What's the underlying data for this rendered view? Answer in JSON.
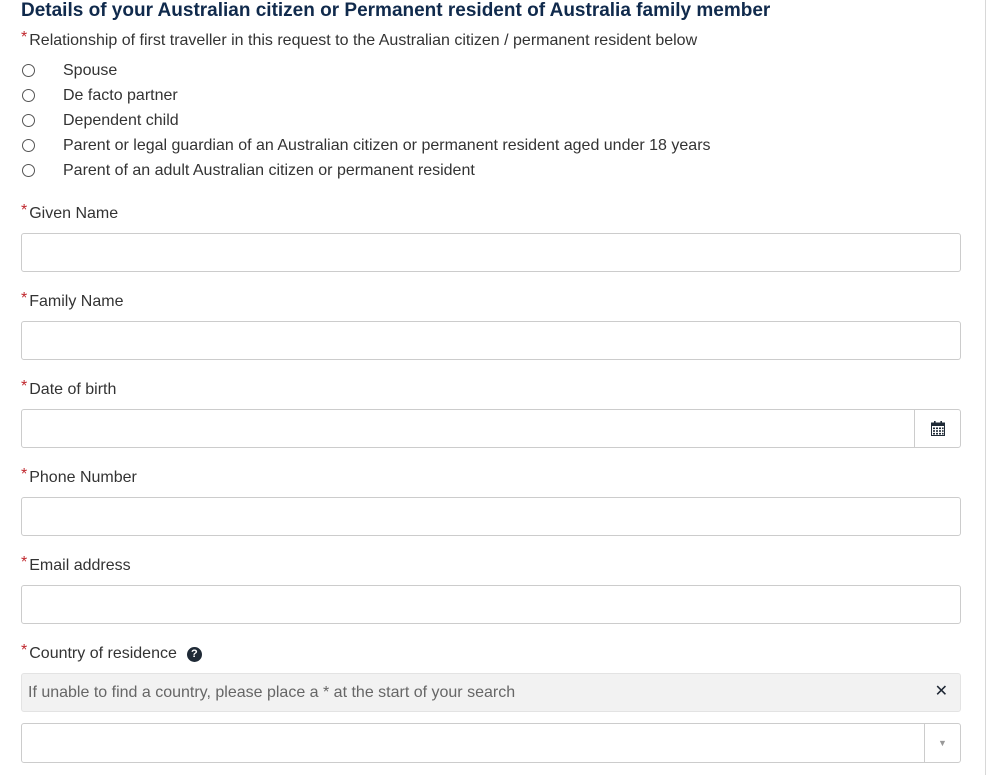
{
  "section": {
    "title": "Details of your Australian citizen or Permanent resident of Australia family member"
  },
  "relationship": {
    "label": "Relationship of first traveller in this request to the Australian citizen / permanent resident below",
    "options": [
      "Spouse",
      "De facto partner",
      "Dependent child",
      "Parent or legal guardian of an Australian citizen or permanent resident aged under 18 years",
      "Parent of an adult Australian citizen or permanent resident"
    ]
  },
  "fields": {
    "required_marker": "*",
    "given_name": {
      "label": "Given Name",
      "value": ""
    },
    "family_name": {
      "label": "Family Name",
      "value": ""
    },
    "date_of_birth": {
      "label": "Date of birth",
      "value": "",
      "icon": "calendar-icon"
    },
    "phone_number": {
      "label": "Phone Number",
      "value": ""
    },
    "email_address": {
      "label": "Email address",
      "value": ""
    },
    "country_of_residence": {
      "label": "Country of residence",
      "help_icon": "question-circle-icon",
      "hint": "If unable to find a country, please place a * at the start of your search",
      "value": ""
    }
  },
  "colors": {
    "title": "#102a4c",
    "required": "#c0272d",
    "border": "#cccccc",
    "hint_background": "#f2f2f2"
  }
}
